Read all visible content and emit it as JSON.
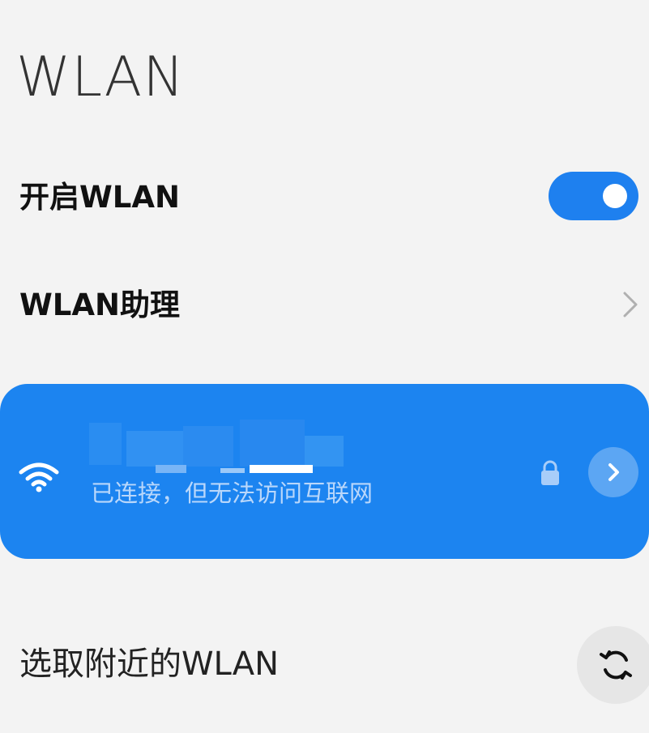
{
  "header": {
    "title": "WLAN"
  },
  "settings": {
    "wlan_toggle_label": "开启WLAN",
    "wlan_toggle_on": true,
    "wlan_assistant_label": "WLAN助理"
  },
  "connected_network": {
    "ssid": "",
    "status": "已连接，但无法访问互联网",
    "secured": true,
    "icons": {
      "signal": "wifi-icon",
      "lock": "lock-icon",
      "details": "chevron-right-icon"
    }
  },
  "nearby": {
    "label": "选取附近的WLAN",
    "refresh_icon": "refresh-icon"
  },
  "colors": {
    "accent": "#1c84f0",
    "background": "#f3f3f3",
    "status_text": "#b9d7fb"
  }
}
